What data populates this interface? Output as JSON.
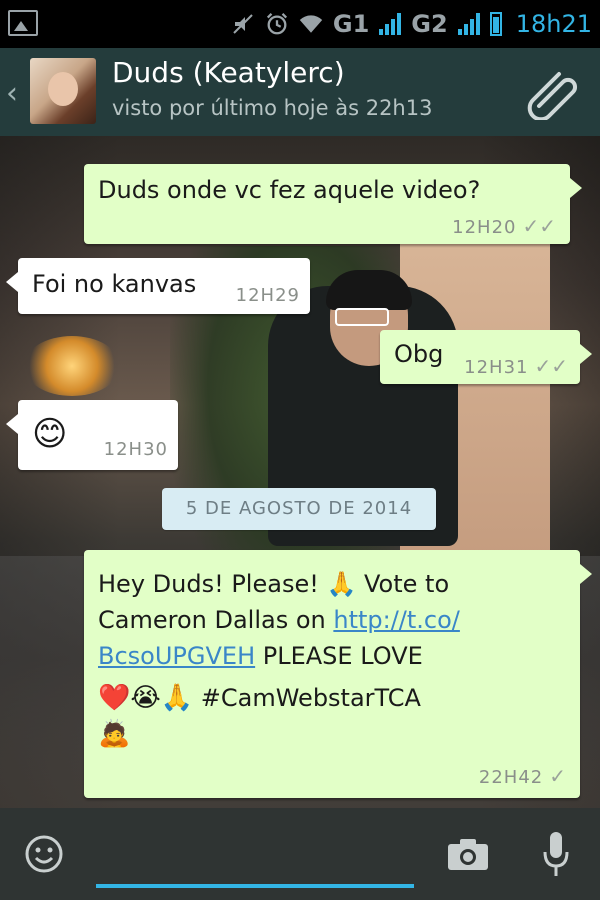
{
  "status_bar": {
    "network1": "G1",
    "network2": "G2",
    "time": "18h21"
  },
  "header": {
    "contact_name": "Duds (Keatylerc)",
    "last_seen": "visto por último hoje às 22h13"
  },
  "messages": [
    {
      "direction": "out",
      "text": "Duds onde vc fez aquele video?",
      "time": "12H20",
      "status": "read"
    },
    {
      "direction": "in",
      "text": "Foi no kanvas",
      "time": "12H29"
    },
    {
      "direction": "out",
      "text": "Obg",
      "time": "12H31",
      "status": "read"
    },
    {
      "direction": "in",
      "text": "😊",
      "time": "12H30"
    }
  ],
  "date_separator": "5 DE AGOSTO DE 2014",
  "last_message": {
    "direction": "out",
    "line1_prefix": "Hey Duds! Please! ",
    "emoji_pray": "🙏",
    "line1_suffix": " Vote to",
    "line2_prefix": "Cameron Dallas on ",
    "link_part1": "http://t.co/",
    "link_part2": "BcsoUPGVEH",
    "line3_suffix": " PLEASE LOVE",
    "emojis_line4": "❤️😭🙏",
    "hashtag": " #CamWebstarTCA",
    "emoji_last": "🙇",
    "time": "22H42",
    "status": "sent"
  },
  "input": {
    "placeholder": ""
  },
  "colors": {
    "accent": "#33b5e5",
    "header_bg": "#243c3c",
    "outgoing_bubble": "#e2ffc7",
    "incoming_bubble": "#ffffff"
  },
  "icons": [
    "image-icon",
    "mute-icon",
    "alarm-icon",
    "wifi-icon",
    "signal-icon",
    "battery-icon",
    "back-chevron-icon",
    "paperclip-icon",
    "smiley-icon",
    "camera-icon",
    "microphone-icon"
  ]
}
